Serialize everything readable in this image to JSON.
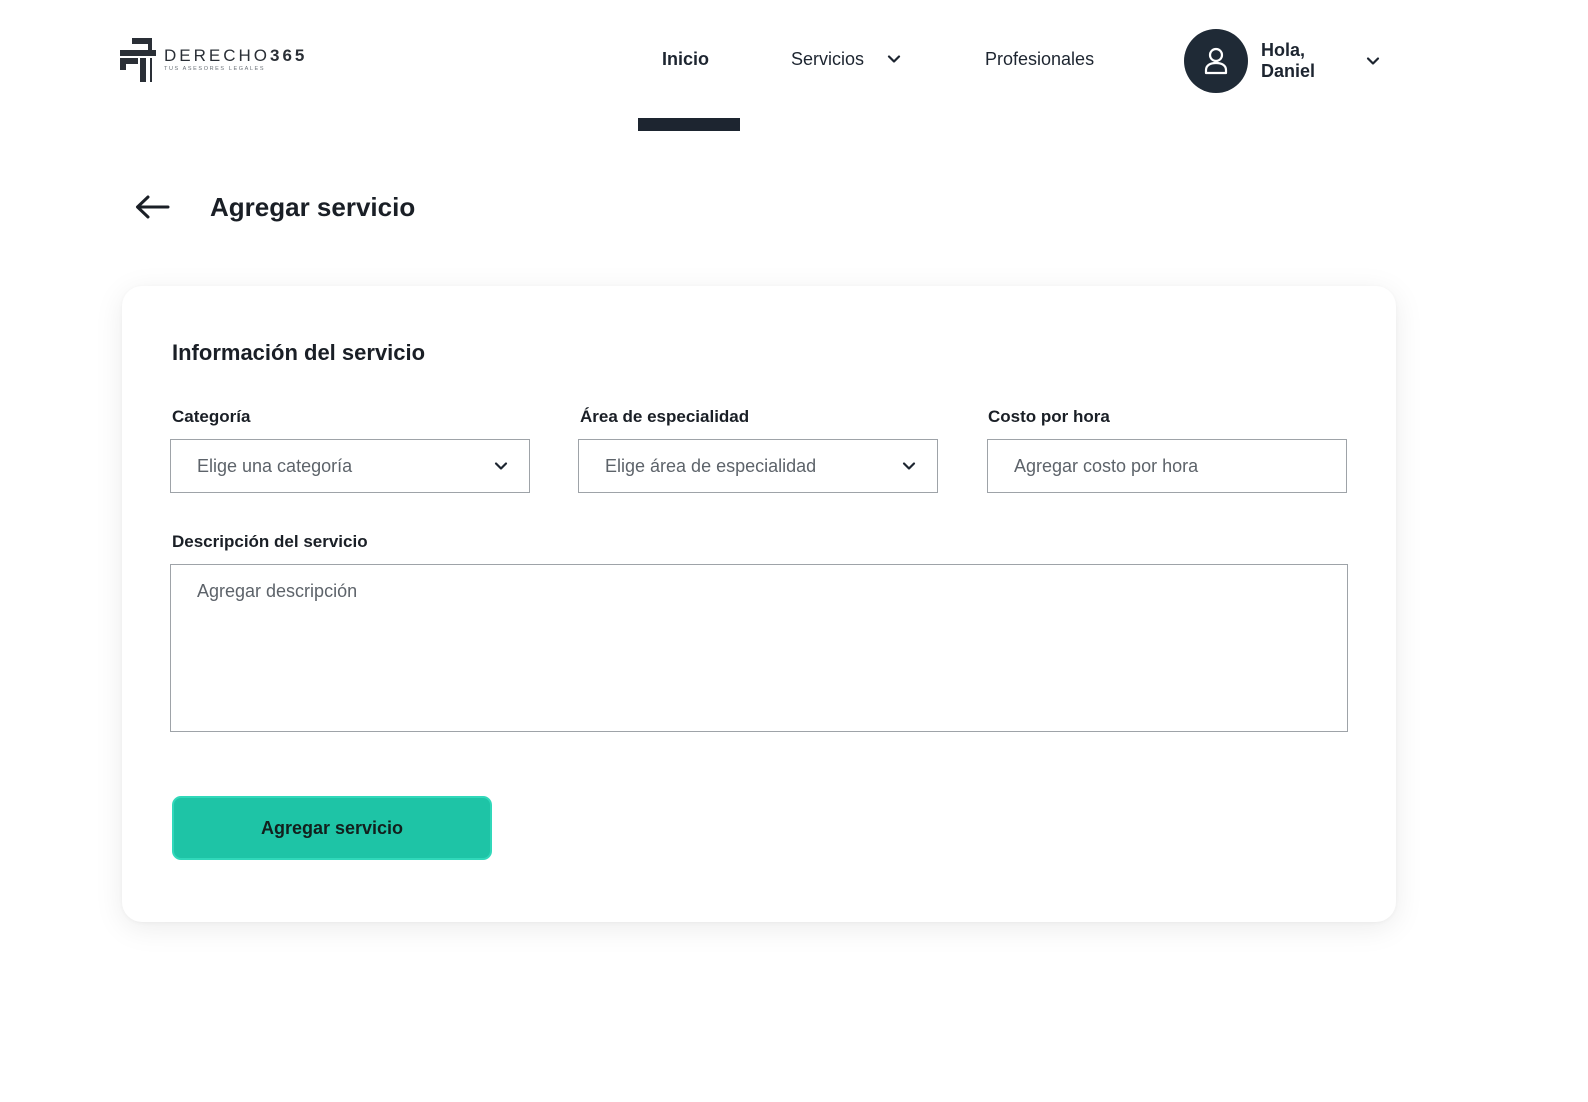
{
  "brand": {
    "name_light": "DERECHO",
    "name_bold": "365",
    "tagline": "TUS ASESORES LEGALES"
  },
  "nav": {
    "items": [
      {
        "label": "Inicio",
        "active": true
      },
      {
        "label": "Servicios",
        "has_dropdown": true
      },
      {
        "label": "Profesionales"
      }
    ]
  },
  "user": {
    "greeting_line1": "Hola,",
    "greeting_line2": "Daniel",
    "avatar_icon": "user-icon"
  },
  "page": {
    "title": "Agregar servicio",
    "back_icon": "arrow-left-icon"
  },
  "form": {
    "section_title": "Información del servicio",
    "categoria": {
      "label": "Categoría",
      "placeholder": "Elige una categoría"
    },
    "area": {
      "label": "Área de especialidad",
      "placeholder": "Elige área de especialidad"
    },
    "costo": {
      "label": "Costo por hora",
      "placeholder": "Agregar costo por hora"
    },
    "descripcion": {
      "label": "Descripción del servicio",
      "placeholder": "Agregar descripción"
    },
    "submit_label": "Agregar servicio"
  },
  "colors": {
    "primary_dark": "#1d2530",
    "accent": "#1ec4a6",
    "input_border": "#9ea3a8"
  }
}
